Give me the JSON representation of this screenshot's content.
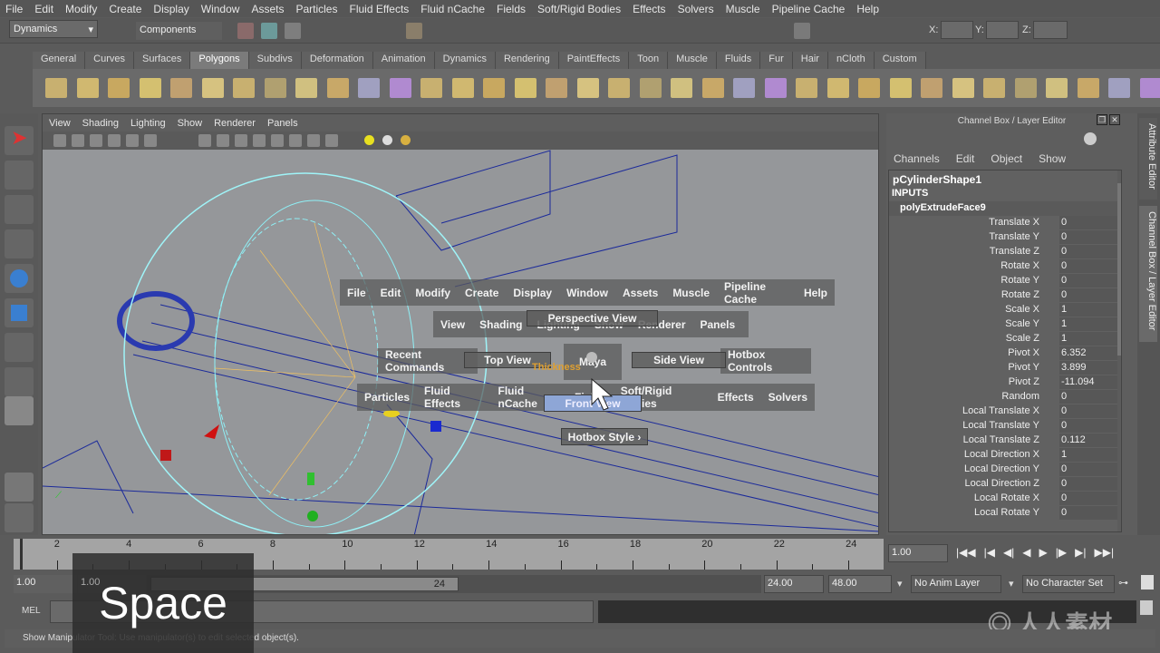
{
  "menubar": [
    "File",
    "Edit",
    "Modify",
    "Create",
    "Display",
    "Window",
    "Assets",
    "Particles",
    "Fluid Effects",
    "Fluid nCache",
    "Fields",
    "Soft/Rigid Bodies",
    "Effects",
    "Solvers",
    "Muscle",
    "Pipeline Cache",
    "Help"
  ],
  "status": {
    "menuset": "Dynamics",
    "selmode": "Components",
    "x_label": "X:",
    "y_label": "Y:",
    "z_label": "Z:"
  },
  "shelf_tabs": [
    "General",
    "Curves",
    "Surfaces",
    "Polygons",
    "Subdivs",
    "Deformation",
    "Animation",
    "Dynamics",
    "Rendering",
    "PaintEffects",
    "Toon",
    "Muscle",
    "Fluids",
    "Fur",
    "Hair",
    "nCloth",
    "Custom"
  ],
  "shelf_active": "Polygons",
  "viewport": {
    "menu": [
      "View",
      "Shading",
      "Lighting",
      "Show",
      "Renderer",
      "Panels"
    ]
  },
  "hotbox": {
    "row1": [
      "File",
      "Edit",
      "Modify",
      "Create",
      "Display",
      "Window",
      "Assets",
      "Muscle",
      "Pipeline Cache",
      "Help"
    ],
    "row2": [
      "View",
      "Shading",
      "Lighting",
      "Show",
      "Renderer",
      "Panels"
    ],
    "row3_left": "Recent Commands",
    "row3_right": "Hotbox Controls",
    "row4": [
      "Particles",
      "Fluid Effects",
      "Fluid nCache",
      "Fields",
      "Soft/Rigid Bodies",
      "Effects",
      "Solvers"
    ],
    "perspective": "Perspective View",
    "top": "Top View",
    "side": "Side View",
    "front": "Front View",
    "center": "Maya",
    "style": "Hotbox Style",
    "thickness": "Thickness"
  },
  "channel_box": {
    "title": "Channel Box / Layer Editor",
    "menu": [
      "Channels",
      "Edit",
      "Object",
      "Show"
    ],
    "object": "pCylinderShape1",
    "inputs": "INPUTS",
    "node": "polyExtrudeFace9",
    "rows": [
      [
        "Translate X",
        "0"
      ],
      [
        "Translate Y",
        "0"
      ],
      [
        "Translate Z",
        "0"
      ],
      [
        "Rotate X",
        "0"
      ],
      [
        "Rotate Y",
        "0"
      ],
      [
        "Rotate Z",
        "0"
      ],
      [
        "Scale X",
        "1"
      ],
      [
        "Scale Y",
        "1"
      ],
      [
        "Scale Z",
        "1"
      ],
      [
        "Pivot X",
        "6.352"
      ],
      [
        "Pivot Y",
        "3.899"
      ],
      [
        "Pivot Z",
        "-11.094"
      ],
      [
        "Random",
        "0"
      ],
      [
        "Local Translate X",
        "0"
      ],
      [
        "Local Translate Y",
        "0"
      ],
      [
        "Local Translate Z",
        "0.112"
      ],
      [
        "Local Direction X",
        "1"
      ],
      [
        "Local Direction Y",
        "0"
      ],
      [
        "Local Direction Z",
        "0"
      ],
      [
        "Local Rotate X",
        "0"
      ],
      [
        "Local Rotate Y",
        "0"
      ]
    ]
  },
  "right_tabs": [
    "Attribute Editor",
    "Channel Box / Layer Editor"
  ],
  "timeline": {
    "ticks": [
      "2",
      "4",
      "6",
      "8",
      "10",
      "12",
      "14",
      "16",
      "18",
      "20",
      "22",
      "24"
    ],
    "current": "1.00"
  },
  "range": {
    "start": "1.00",
    "inner_start": "1.00",
    "inner_end_label": "24",
    "end": "24.00",
    "max": "48.00",
    "anim_layer": "No Anim Layer",
    "char_set": "No Character Set"
  },
  "mel": {
    "label": "MEL"
  },
  "help_line": "Show Manipulator Tool: Use manipulator(s) to edit selected object(s).",
  "overlay_key": "Space",
  "watermark": "人人素材"
}
